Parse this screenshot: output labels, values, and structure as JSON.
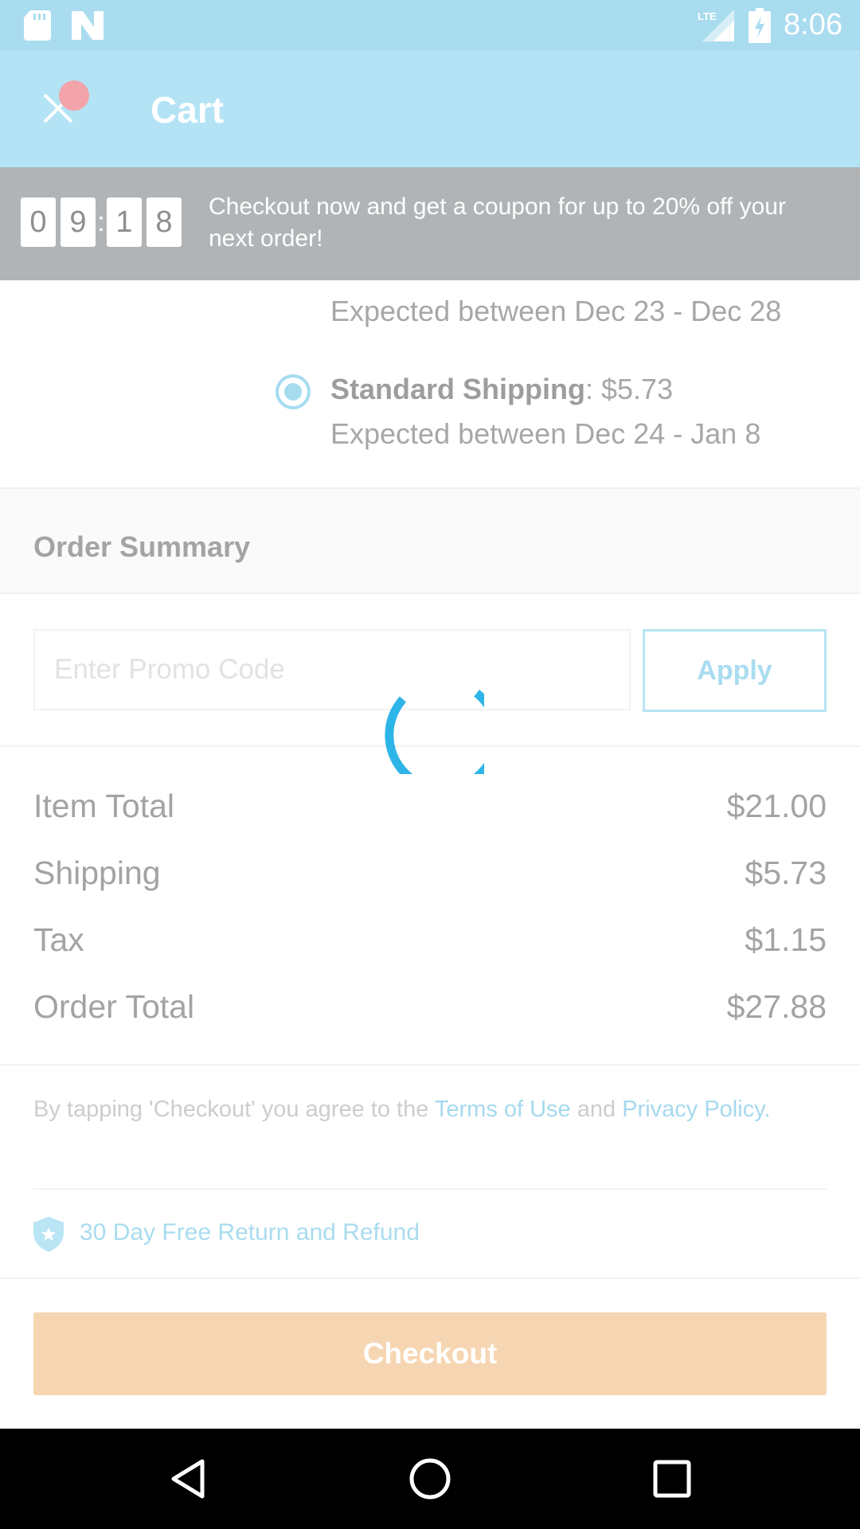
{
  "status_bar": {
    "time": "8:06",
    "icons": [
      "sd-card-icon",
      "n-notification-icon",
      "lte-signal-icon",
      "battery-charging-icon"
    ]
  },
  "app_bar": {
    "title": "Cart",
    "close_icon": "close-icon"
  },
  "promo_banner": {
    "timer_digits": [
      "0",
      "9",
      "1",
      "8"
    ],
    "timer_separator": ":",
    "message": "Checkout now and get a coupon for up to 20% off your next order!"
  },
  "shipping": {
    "prev_option_expected": "Expected between Dec 23 - Dec 28",
    "standard": {
      "name": "Standard Shipping",
      "price": ": $5.73",
      "expected": "Expected between Dec 24 - Jan 8",
      "selected": true
    }
  },
  "order_summary": {
    "title": "Order Summary",
    "promo_placeholder": "Enter Promo Code",
    "apply_label": "Apply",
    "rows": [
      {
        "label": "Item Total",
        "value": "$21.00"
      },
      {
        "label": "Shipping",
        "value": "$5.73"
      },
      {
        "label": "Tax",
        "value": "$1.15"
      },
      {
        "label": "Order Total",
        "value": "$27.88"
      }
    ]
  },
  "terms": {
    "prefix": "By tapping 'Checkout' you agree to the ",
    "terms_link": "Terms of Use",
    "middle": " and ",
    "privacy_link": "Privacy Policy",
    "suffix": "."
  },
  "guarantee": {
    "text": "30 Day Free Return and Refund",
    "icon": "shield-star-icon"
  },
  "checkout": {
    "label": "Checkout"
  },
  "loading": {
    "icon": "loading-spinner-icon"
  },
  "colors": {
    "app_bar": "#b3e3f5",
    "status_bar": "#a9dcef",
    "banner": "#b1b4b6",
    "accent": "#a9dcef",
    "spinner": "#2eb5e8",
    "checkout": "#f6d6b2"
  }
}
